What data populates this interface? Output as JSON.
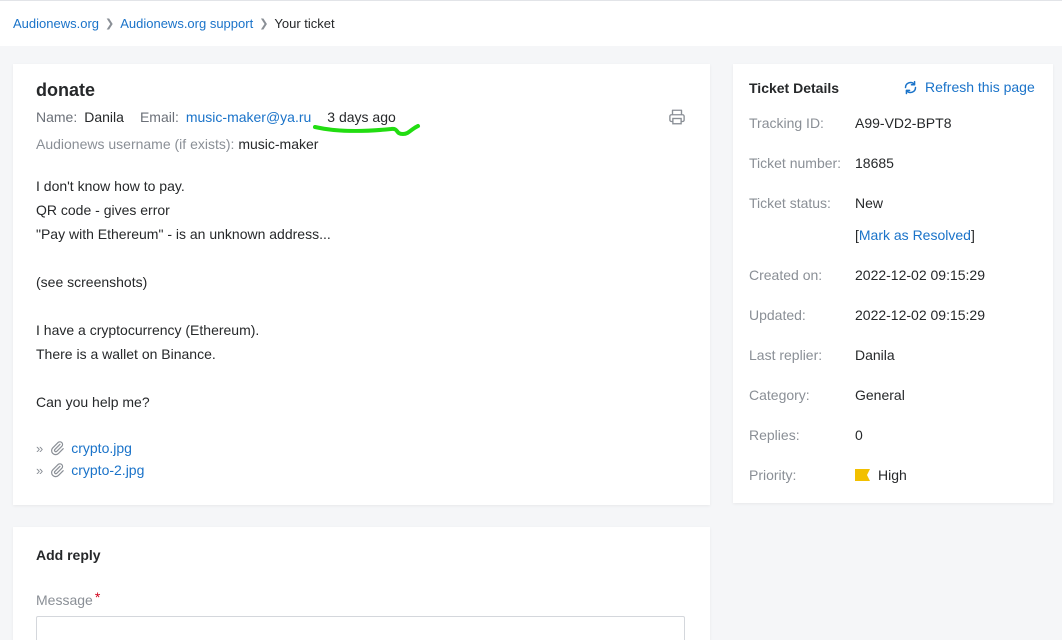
{
  "breadcrumb": {
    "items": [
      "Audionews.org",
      "Audionews.org support"
    ],
    "current": "Your ticket"
  },
  "ticket": {
    "title": "donate",
    "name_label": "Name:",
    "name": "Danila",
    "email_label": "Email:",
    "email": "music-maker@ya.ru",
    "time_ago": "3 days ago",
    "username_label": "Audionews username (if exists):",
    "username": "music-maker",
    "message_lines": [
      "I don't know how to pay.",
      "QR code - gives error",
      "\"Pay with Ethereum\" - is an unknown address...",
      "",
      "(see screenshots)",
      "",
      "I have a cryptocurrency (Ethereum).",
      "There is a wallet on Binance.",
      "",
      "Can you help me?"
    ],
    "attachments": [
      "crypto.jpg",
      "crypto-2.jpg"
    ],
    "highlight_color": "#22dd11"
  },
  "details": {
    "title": "Ticket Details",
    "refresh_label": "Refresh this page",
    "tracking_id_label": "Tracking ID:",
    "tracking_id": "A99-VD2-BPT8",
    "ticket_number_label": "Ticket number:",
    "ticket_number": "18685",
    "status_label": "Ticket status:",
    "status": "New",
    "resolve_open": "[",
    "resolve_label": "Mark as Resolved",
    "resolve_close": "]",
    "created_label": "Created on:",
    "created": "2022-12-02 09:15:29",
    "updated_label": "Updated:",
    "updated": "2022-12-02 09:15:29",
    "last_replier_label": "Last replier:",
    "last_replier": "Danila",
    "category_label": "Category:",
    "category": "General",
    "replies_label": "Replies:",
    "replies": "0",
    "priority_label": "Priority:",
    "priority": "High",
    "priority_color": "#f2c000"
  },
  "reply": {
    "title": "Add reply",
    "message_label": "Message",
    "required_mark": "*"
  }
}
